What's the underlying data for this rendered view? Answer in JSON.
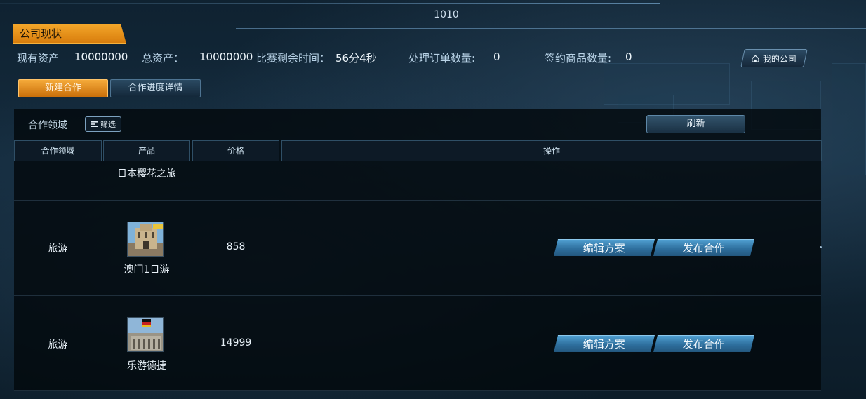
{
  "header": {
    "room_number": "1010",
    "title": "公司现状"
  },
  "stats": {
    "current_assets_label": "现有资产",
    "current_assets_value": "10000000",
    "total_assets_label": "总资产：",
    "total_assets_value": "10000000",
    "time_left_label": "比赛剩余时间：",
    "time_left_value": "56分4秒",
    "orders_label": "处理订单数量:",
    "orders_value": "0",
    "contracts_label": "签约商品数量:",
    "contracts_value": "0"
  },
  "my_company_label": "我的公司",
  "tabs": [
    "新建合作",
    "合作进度详情"
  ],
  "filter": {
    "label": "合作领域",
    "button": "筛选"
  },
  "refresh_label": "刷新",
  "table": {
    "headers": [
      "合作领域",
      "产品",
      "价格",
      "操作"
    ],
    "partial_row": {
      "product": "日本樱花之旅"
    },
    "rows": [
      {
        "domain": "旅游",
        "product": "澳门1日游",
        "price": "858",
        "edit": "编辑方案",
        "publish": "发布合作"
      },
      {
        "domain": "旅游",
        "product": "乐游德捷",
        "price": "14999",
        "edit": "编辑方案",
        "publish": "发布合作"
      }
    ]
  },
  "colors": {
    "accent_orange": "#f4a72a",
    "action_blue": "#3f8cc0",
    "panel_dark": "#05090d"
  },
  "icons": [
    "home-icon",
    "filter-list-icon"
  ]
}
